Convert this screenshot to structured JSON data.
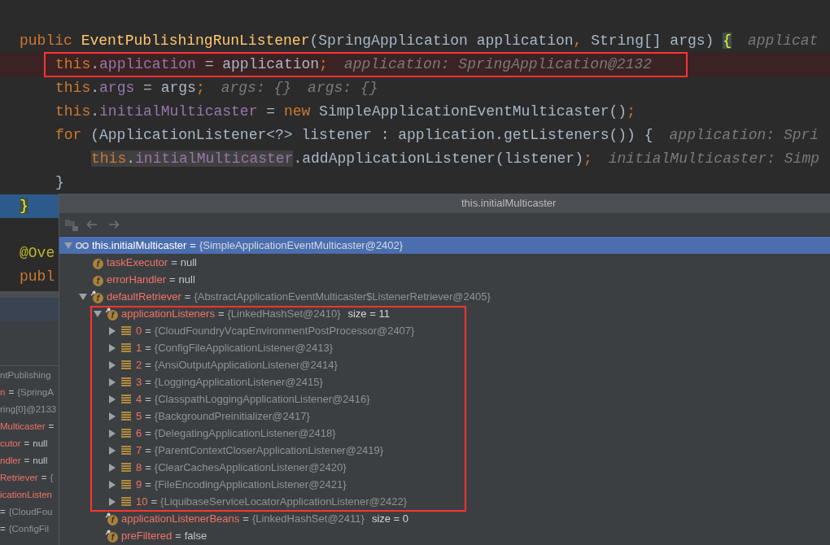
{
  "code": {
    "lines": [
      {
        "breakpoint": false,
        "selected": false,
        "boxed": false,
        "tokens": [
          {
            "kind": "keyword",
            "text": "public "
          },
          {
            "kind": "method",
            "text": "EventPublishingRunListener"
          },
          {
            "kind": "plain",
            "text": "(SpringApplication application"
          },
          {
            "kind": "punct",
            "text": ", "
          },
          {
            "kind": "plain",
            "text": "String[] args) "
          },
          {
            "kind": "brace_match",
            "text": "{"
          }
        ],
        "hints": [
          "applicat"
        ],
        "children": [
          {
            "breakpoint": true,
            "selected": false,
            "boxed": true,
            "tokens": [
              {
                "kind": "keyword",
                "text": "this"
              },
              {
                "kind": "plain",
                "text": "."
              },
              {
                "kind": "field",
                "text": "application"
              },
              {
                "kind": "plain",
                "text": " = application"
              },
              {
                "kind": "punct",
                "text": ";"
              }
            ],
            "hints": [
              "application: SpringApplication@2132"
            ]
          },
          {
            "breakpoint": false,
            "selected": false,
            "boxed": false,
            "tokens": [
              {
                "kind": "keyword",
                "text": "this"
              },
              {
                "kind": "plain",
                "text": "."
              },
              {
                "kind": "field",
                "text": "args"
              },
              {
                "kind": "plain",
                "text": " = args"
              },
              {
                "kind": "punct",
                "text": ";"
              }
            ],
            "hints": [
              "args: {}",
              "args: {}"
            ]
          },
          {
            "breakpoint": false,
            "selected": false,
            "boxed": false,
            "tokens": [
              {
                "kind": "keyword",
                "text": "this"
              },
              {
                "kind": "plain",
                "text": "."
              },
              {
                "kind": "field",
                "text": "initialMulticaster"
              },
              {
                "kind": "plain",
                "text": " = "
              },
              {
                "kind": "keyword",
                "text": "new"
              },
              {
                "kind": "plain",
                "text": " SimpleApplicationEventMulticaster()"
              },
              {
                "kind": "punct",
                "text": ";"
              }
            ]
          },
          {
            "breakpoint": false,
            "selected": false,
            "boxed": false,
            "tokens": [
              {
                "kind": "keyword",
                "text": "for"
              },
              {
                "kind": "plain",
                "text": " (ApplicationListener<?> listener : application.getListeners()) {"
              }
            ],
            "hints": [
              "application: Spri"
            ],
            "children": [
              {
                "breakpoint": false,
                "selected": false,
                "boxed": false,
                "tokens": [
                  {
                    "kind": "usage",
                    "tokens": [
                      {
                        "kind": "keyword",
                        "text": "this"
                      },
                      {
                        "kind": "plain",
                        "text": "."
                      },
                      {
                        "kind": "field",
                        "text": "initialMulticaster"
                      }
                    ]
                  },
                  {
                    "kind": "plain",
                    "text": ".addApplicationListener(listener)"
                  },
                  {
                    "kind": "punct",
                    "text": ";"
                  }
                ],
                "hints": [
                  "initialMulticaster: Simp"
                ]
              }
            ]
          },
          {
            "breakpoint": false,
            "selected": false,
            "boxed": false,
            "tokens": [
              {
                "kind": "plain",
                "text": "}"
              }
            ]
          }
        ]
      },
      {
        "breakpoint": false,
        "selected": true,
        "boxed": false,
        "tokens": [
          {
            "kind": "brace_match",
            "text": "}"
          }
        ]
      },
      {
        "breakpoint": false,
        "selected": false,
        "boxed": false
      },
      {
        "breakpoint": false,
        "selected": false,
        "boxed": false,
        "tokens": [
          {
            "kind": "annotation",
            "text": "@Ove"
          }
        ]
      },
      {
        "breakpoint": false,
        "selected": false,
        "boxed": false,
        "tokens": [
          {
            "kind": "keyword",
            "text": "publ"
          }
        ]
      }
    ]
  },
  "variables": {
    "rows": [
      {
        "value": "ntPublishing",
        "literal": false
      },
      {
        "name": "n",
        "sep": "=",
        "value": "{SpringA",
        "literal": false
      },
      {
        "value": "ring[0]@2133",
        "literal": false
      },
      {
        "name": "Multicaster",
        "sep": "="
      },
      {
        "name": "cutor",
        "sep": "=",
        "value": "null",
        "literal": true
      },
      {
        "name": "ndler",
        "sep": "=",
        "value": "null",
        "literal": true
      },
      {
        "name": "Retriever",
        "sep": "=",
        "value": "{",
        "literal": false
      },
      {
        "name": "icationListen"
      },
      {
        "sep": "=",
        "value": "{CloudFou",
        "literal": false
      },
      {
        "sep": "=",
        "value": "{ConfigFil",
        "literal": false
      }
    ]
  },
  "popup": {
    "title": "this.initialMulticaster",
    "tree": [
      {
        "kind": "watch",
        "name": "this.initialMulticaster",
        "sep": "=",
        "value": "{SimpleApplicationEventMulticaster@2402}",
        "literal": false,
        "selected": true,
        "expanded": true,
        "boxed": false,
        "children": [
          {
            "kind": "field",
            "badge": "f",
            "final": false,
            "name": "taskExecutor",
            "sep": "=",
            "value": "null",
            "literal": true,
            "selected": false,
            "boxed": false
          },
          {
            "kind": "field",
            "badge": "f",
            "final": false,
            "name": "errorHandler",
            "sep": "=",
            "value": "null",
            "literal": true,
            "selected": false,
            "boxed": false
          },
          {
            "kind": "field",
            "badge": "f",
            "final": true,
            "name": "defaultRetriever",
            "sep": "=",
            "value": "{AbstractApplicationEventMulticaster$ListenerRetriever@2405}",
            "literal": false,
            "selected": false,
            "expanded": true,
            "boxed": false,
            "children": [
              {
                "kind": "field",
                "badge": "f",
                "final": true,
                "name": "applicationListeners",
                "sep": "=",
                "value": "{LinkedHashSet@2410}",
                "literal": false,
                "extra": "size = 11",
                "selected": false,
                "expanded": true,
                "boxed": true,
                "children": [
                  {
                    "kind": "element",
                    "name": "0",
                    "sep": "=",
                    "value": "{CloudFoundryVcapEnvironmentPostProcessor@2407}",
                    "literal": false,
                    "selected": false,
                    "expanded": false,
                    "boxed": false
                  },
                  {
                    "kind": "element",
                    "name": "1",
                    "sep": "=",
                    "value": "{ConfigFileApplicationListener@2413}",
                    "literal": false,
                    "selected": false,
                    "expanded": false,
                    "boxed": false
                  },
                  {
                    "kind": "element",
                    "name": "2",
                    "sep": "=",
                    "value": "{AnsiOutputApplicationListener@2414}",
                    "literal": false,
                    "selected": false,
                    "expanded": false,
                    "boxed": false
                  },
                  {
                    "kind": "element",
                    "name": "3",
                    "sep": "=",
                    "value": "{LoggingApplicationListener@2415}",
                    "literal": false,
                    "selected": false,
                    "expanded": false,
                    "boxed": false
                  },
                  {
                    "kind": "element",
                    "name": "4",
                    "sep": "=",
                    "value": "{ClasspathLoggingApplicationListener@2416}",
                    "literal": false,
                    "selected": false,
                    "expanded": false,
                    "boxed": false
                  },
                  {
                    "kind": "element",
                    "name": "5",
                    "sep": "=",
                    "value": "{BackgroundPreinitializer@2417}",
                    "literal": false,
                    "selected": false,
                    "expanded": false,
                    "boxed": false
                  },
                  {
                    "kind": "element",
                    "name": "6",
                    "sep": "=",
                    "value": "{DelegatingApplicationListener@2418}",
                    "literal": false,
                    "selected": false,
                    "expanded": false,
                    "boxed": false
                  },
                  {
                    "kind": "element",
                    "name": "7",
                    "sep": "=",
                    "value": "{ParentContextCloserApplicationListener@2419}",
                    "literal": false,
                    "selected": false,
                    "expanded": false,
                    "boxed": false
                  },
                  {
                    "kind": "element",
                    "name": "8",
                    "sep": "=",
                    "value": "{ClearCachesApplicationListener@2420}",
                    "literal": false,
                    "selected": false,
                    "expanded": false,
                    "boxed": false
                  },
                  {
                    "kind": "element",
                    "name": "9",
                    "sep": "=",
                    "value": "{FileEncodingApplicationListener@2421}",
                    "literal": false,
                    "selected": false,
                    "expanded": false,
                    "boxed": false
                  },
                  {
                    "kind": "element",
                    "name": "10",
                    "sep": "=",
                    "value": "{LiquibaseServiceLocatorApplicationListener@2422}",
                    "literal": false,
                    "selected": false,
                    "expanded": false,
                    "boxed": false
                  }
                ]
              },
              {
                "kind": "field",
                "badge": "f",
                "final": true,
                "name": "applicationListenerBeans",
                "sep": "=",
                "value": "{LinkedHashSet@2411}",
                "literal": false,
                "extra": "size = 0",
                "selected": false,
                "boxed": false
              },
              {
                "kind": "field",
                "badge": "f",
                "final": true,
                "name": "preFiltered",
                "sep": "=",
                "value": "false",
                "literal": true,
                "selected": false,
                "boxed": false
              }
            ]
          }
        ]
      }
    ]
  }
}
